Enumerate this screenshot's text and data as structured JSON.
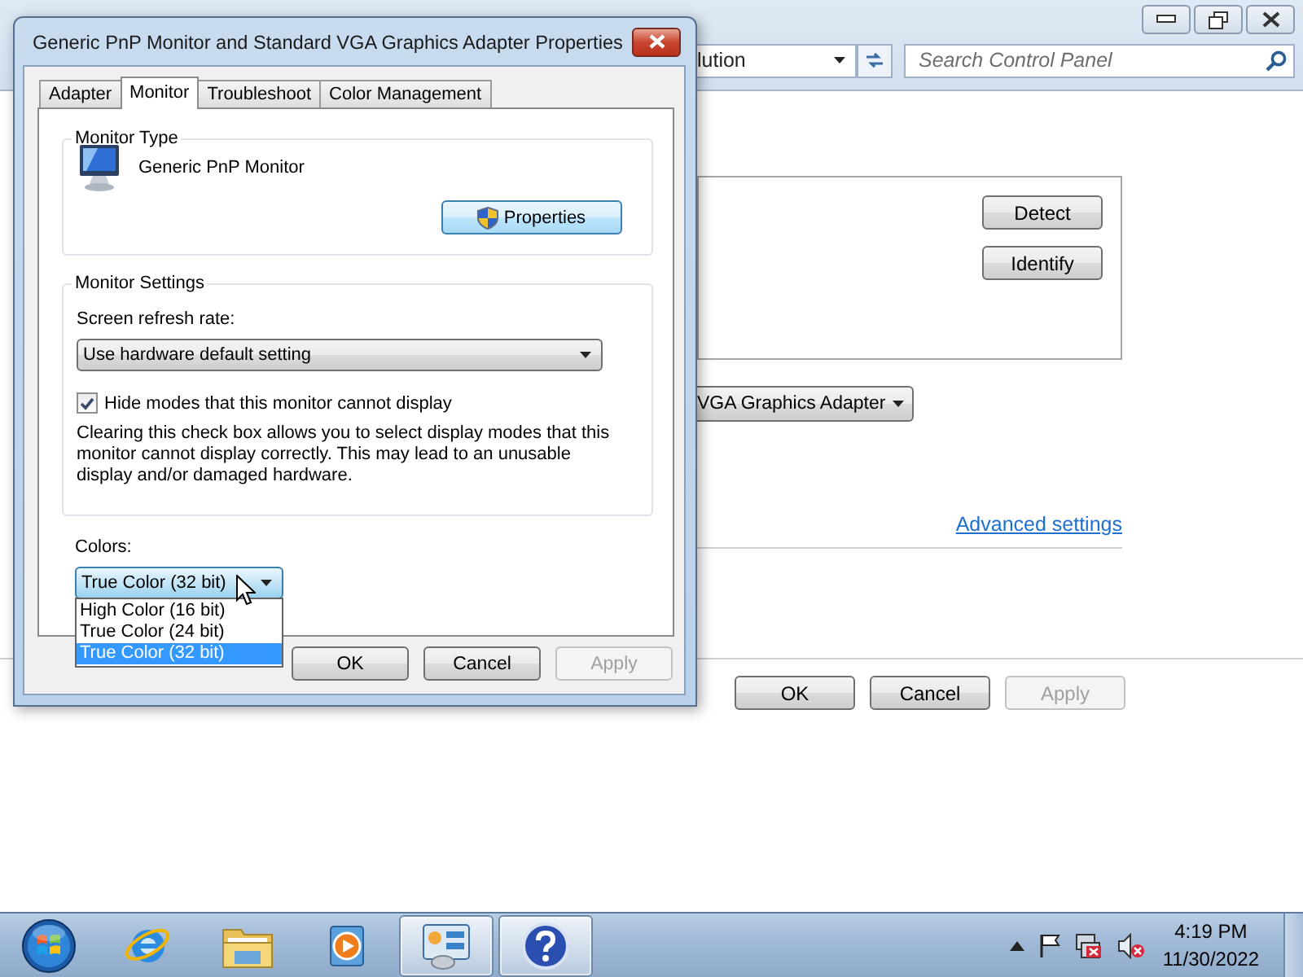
{
  "desktop_window": {
    "address": {
      "breadcrumb": "lution"
    },
    "search": {
      "placeholder": "Search Control Panel"
    },
    "display_buttons": [
      {
        "label": "Detect"
      },
      {
        "label": "Identify"
      }
    ],
    "display_dropdown": {
      "value": "VGA Graphics Adapter"
    },
    "advanced_link": "Advanced settings",
    "buttons": [
      {
        "label": "OK",
        "disabled": false
      },
      {
        "label": "Cancel",
        "disabled": false
      },
      {
        "label": "Apply",
        "disabled": true
      }
    ]
  },
  "dialog": {
    "title": "Generic PnP Monitor and Standard VGA Graphics Adapter Properties",
    "tabs": [
      {
        "label": "Adapter",
        "selected": false
      },
      {
        "label": "Monitor",
        "selected": true
      },
      {
        "label": "Troubleshoot",
        "selected": false
      },
      {
        "label": "Color Management",
        "selected": false
      }
    ],
    "monitor_type": {
      "label": "Monitor Type",
      "monitor_name": "Generic PnP Monitor",
      "properties_button": "Properties"
    },
    "monitor_settings": {
      "label": "Monitor Settings",
      "refresh_label": "Screen refresh rate:",
      "refresh_value": "Use hardware default setting",
      "hide_modes": {
        "label": "Hide modes that this monitor cannot display",
        "checked": true
      },
      "description": "Clearing this check box allows you to select display modes that this monitor cannot display correctly. This may lead to an unusable display and/or damaged hardware."
    },
    "colors": {
      "label": "Colors:",
      "value": "True Color (32 bit)",
      "expanded": true,
      "options": [
        {
          "label": "High Color (16 bit)",
          "selected": false
        },
        {
          "label": "True Color (24 bit)",
          "selected": false
        },
        {
          "label": "True Color (32 bit)",
          "selected": true
        }
      ]
    },
    "buttons": [
      {
        "label": "OK",
        "disabled": false
      },
      {
        "label": "Cancel",
        "disabled": false
      },
      {
        "label": "Apply",
        "disabled": true
      }
    ]
  },
  "taskbar": {
    "items": [
      {
        "kind": "start",
        "open": false
      },
      {
        "kind": "browser",
        "open": false
      },
      {
        "kind": "folder",
        "open": false
      },
      {
        "kind": "media",
        "open": false
      },
      {
        "kind": "control-panel",
        "open": true
      },
      {
        "kind": "help",
        "open": true
      }
    ],
    "clock": {
      "time": "4:19 PM",
      "date": "11/30/2022"
    }
  }
}
